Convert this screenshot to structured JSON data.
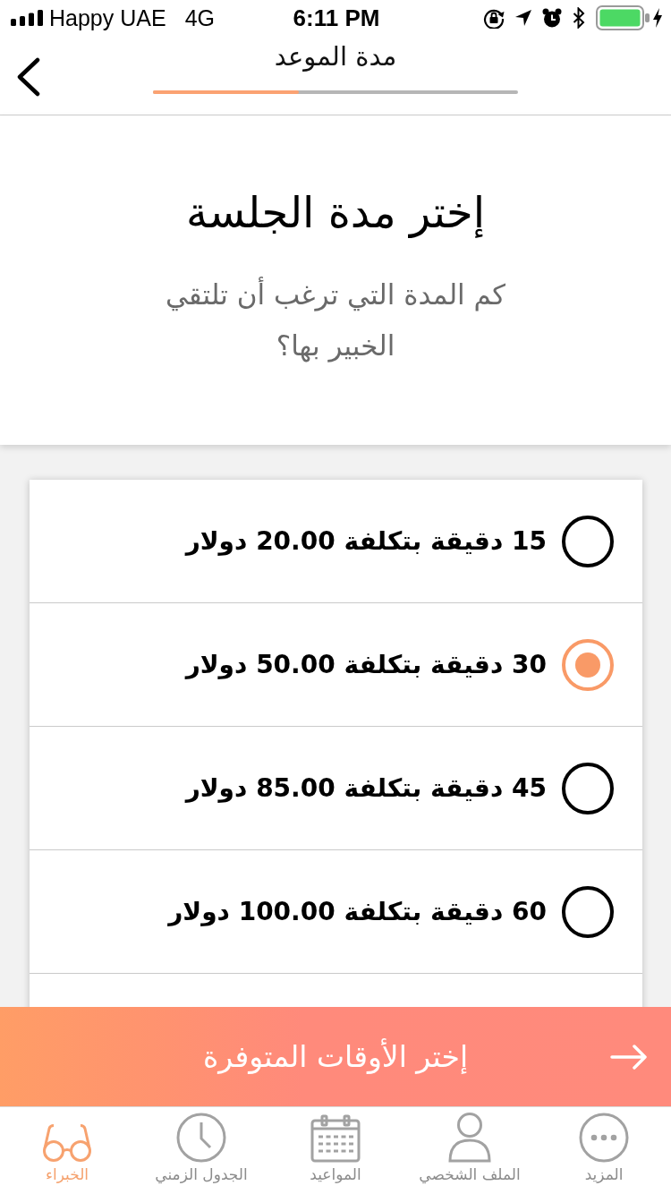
{
  "status_bar": {
    "carrier": "Happy UAE",
    "network": "4G",
    "time": "6:11 PM"
  },
  "header": {
    "title": "مدة الموعد",
    "progress": {
      "level": 0.4
    }
  },
  "intro": {
    "title": "إختر مدة الجلسة",
    "subtitle": "كم المدة التي ترغب أن تلتقي الخبير بها؟"
  },
  "options": [
    {
      "label": "15 دقيقة بتكلفة 20.00 دولار",
      "selected": false
    },
    {
      "label": "30 دقيقة بتكلفة 50.00 دولار",
      "selected": true
    },
    {
      "label": "45 دقيقة بتكلفة 85.00 دولار",
      "selected": false
    },
    {
      "label": "60 دقيقة بتكلفة 100.00 دولار",
      "selected": false
    }
  ],
  "action_button": {
    "label": "إختر الأوقات المتوفرة"
  },
  "tabs": [
    {
      "label": "المزيد",
      "selected": false
    },
    {
      "label": "الملف الشخصي",
      "selected": false
    },
    {
      "label": "المواعيد",
      "selected": false
    },
    {
      "label": "الجدول الزمني",
      "selected": false
    },
    {
      "label": "الخبراء",
      "selected": true
    }
  ]
}
